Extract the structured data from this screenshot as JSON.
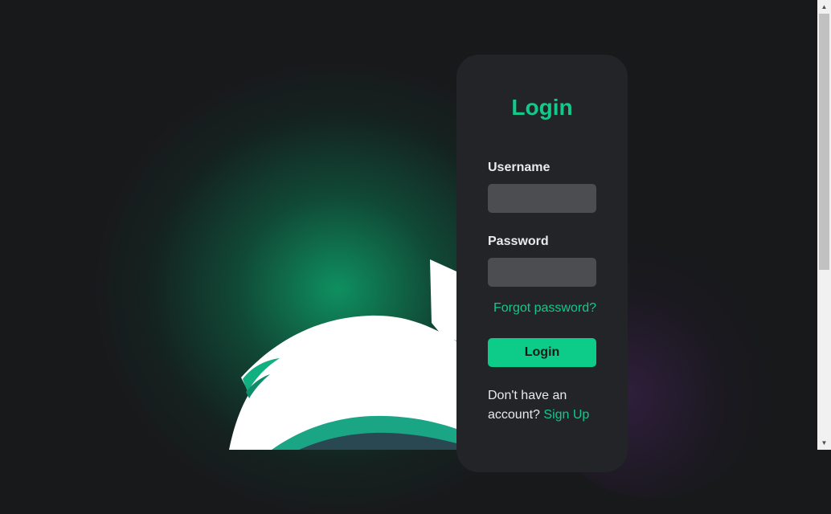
{
  "login_card": {
    "title": "Login",
    "username_label": "Username",
    "username_value": "",
    "password_label": "Password",
    "password_value": "",
    "forgot_password": "Forgot password?",
    "login_button": "Login",
    "signup_prompt": "Don't have an account?",
    "signup_link": "Sign Up"
  },
  "scrollbar": {
    "up_arrow": "▲",
    "down_arrow": "▼"
  },
  "colors": {
    "accent": "#12c98a",
    "background": "#18191b",
    "card": "#232427",
    "input": "#4c4d50"
  }
}
